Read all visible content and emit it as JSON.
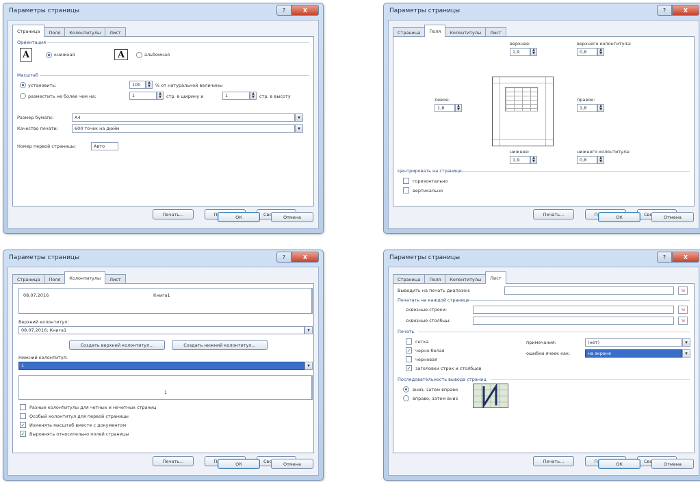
{
  "dialog_title": "Параметры страницы",
  "window_controls": {
    "help": "?",
    "close": "X"
  },
  "tabs": [
    "Страница",
    "Поля",
    "Колонтитулы",
    "Лист"
  ],
  "buttons": {
    "print": "Печать...",
    "preview": "Просмотр",
    "properties": "Свойства...",
    "ok": "ОК",
    "cancel": "Отмена"
  },
  "page_tab": {
    "orientation_label": "Ориентация",
    "portrait": "книжная",
    "landscape": "альбомная",
    "orient_glyph": "A",
    "scale_label": "Масштаб",
    "set_label": "установить:",
    "set_value": "100",
    "set_suffix": "% от натуральной величины",
    "fit_label": "разместить не более чем на:",
    "fit_width_value": "1",
    "fit_width_suffix": "стр. в ширину и",
    "fit_height_value": "1",
    "fit_height_suffix": "стр. в высоту",
    "paper_size_label": "Размер бумаги:",
    "paper_size_value": "А4",
    "print_quality_label": "Качество печати:",
    "print_quality_value": "600 точек на дюйм",
    "first_page_label": "Номер первой страницы:",
    "first_page_value": "Авто"
  },
  "margins_tab": {
    "top_label": "верхнее:",
    "top_value": "1,9",
    "header_label": "верхнего колонтитула:",
    "header_value": "0,8",
    "left_label": "левое:",
    "left_value": "1,8",
    "right_label": "правое:",
    "right_value": "1,8",
    "bottom_label": "нижнее:",
    "bottom_value": "1,9",
    "footer_label": "нижнего колонтитула:",
    "footer_value": "0,8",
    "center_label": "Центрировать на странице",
    "horizontal": "горизонтально",
    "vertical": "вертикально"
  },
  "hf_tab": {
    "preview_left": "08.07.2016",
    "preview_center": "Книга1",
    "header_label": "Верхний колонтитул:",
    "header_value": "08.07.2016; Книга1",
    "create_header": "Создать верхний колонтитул...",
    "create_footer": "Создать нижний колонтитул...",
    "footer_label": "Нижний колонтитул:",
    "footer_value": "1",
    "footer_preview": "1",
    "opt_odd_even": "Разные колонтитулы для четных и нечетных страниц",
    "opt_first_page": "Особый колонтитул для первой страницы",
    "opt_scale": "Изменять масштаб вместе с документом",
    "opt_align": "Выровнять относительно полей страницы"
  },
  "sheet_tab": {
    "print_area_label": "Выводить на печать диапазон:",
    "print_each_page_label": "Печатать на каждой странице",
    "rows_label": "сквозные строки:",
    "cols_label": "сквозные столбцы:",
    "print_label": "Печать",
    "grid": "сетка",
    "bw": "черно-белая",
    "draft": "черновая",
    "headings": "заголовки строк и столбцов",
    "notes_label": "примечания:",
    "notes_value": "(нет)",
    "errors_label": "ошибки ячеек как:",
    "errors_value": "на экране",
    "order_label": "Последовательность вывода страниц",
    "down_over": "вниз, затем вправо",
    "over_down": "вправо, затем вниз",
    "range_icon": "⇲"
  },
  "colors": {
    "title_bar": "#c5d8ef",
    "selection": "#3a6fc9",
    "accent": "#2a4a80"
  }
}
